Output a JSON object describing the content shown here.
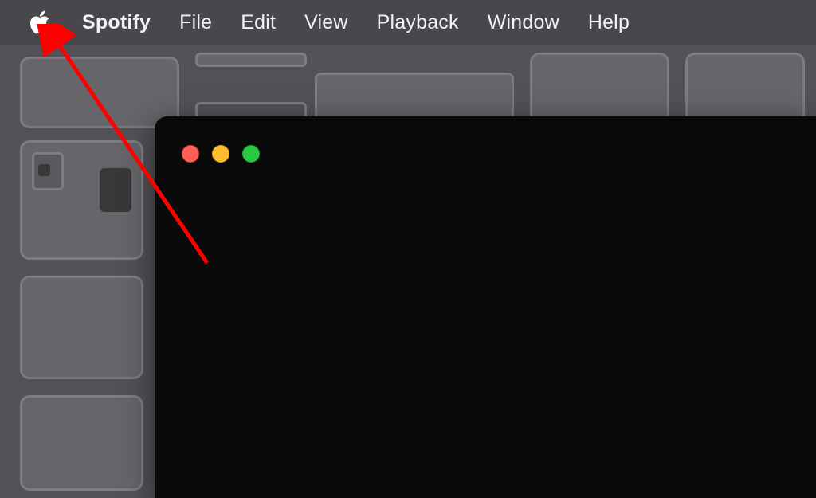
{
  "menubar": {
    "apple_menu_label": "Apple menu",
    "app_name": "Spotify",
    "items": [
      {
        "label": "File"
      },
      {
        "label": "Edit"
      },
      {
        "label": "View"
      },
      {
        "label": "Playback"
      },
      {
        "label": "Window"
      },
      {
        "label": "Help"
      }
    ]
  },
  "window": {
    "close_label": "Close",
    "minimize_label": "Minimize",
    "maximize_label": "Maximize"
  },
  "annotation": {
    "arrow_color": "#ff0000"
  }
}
